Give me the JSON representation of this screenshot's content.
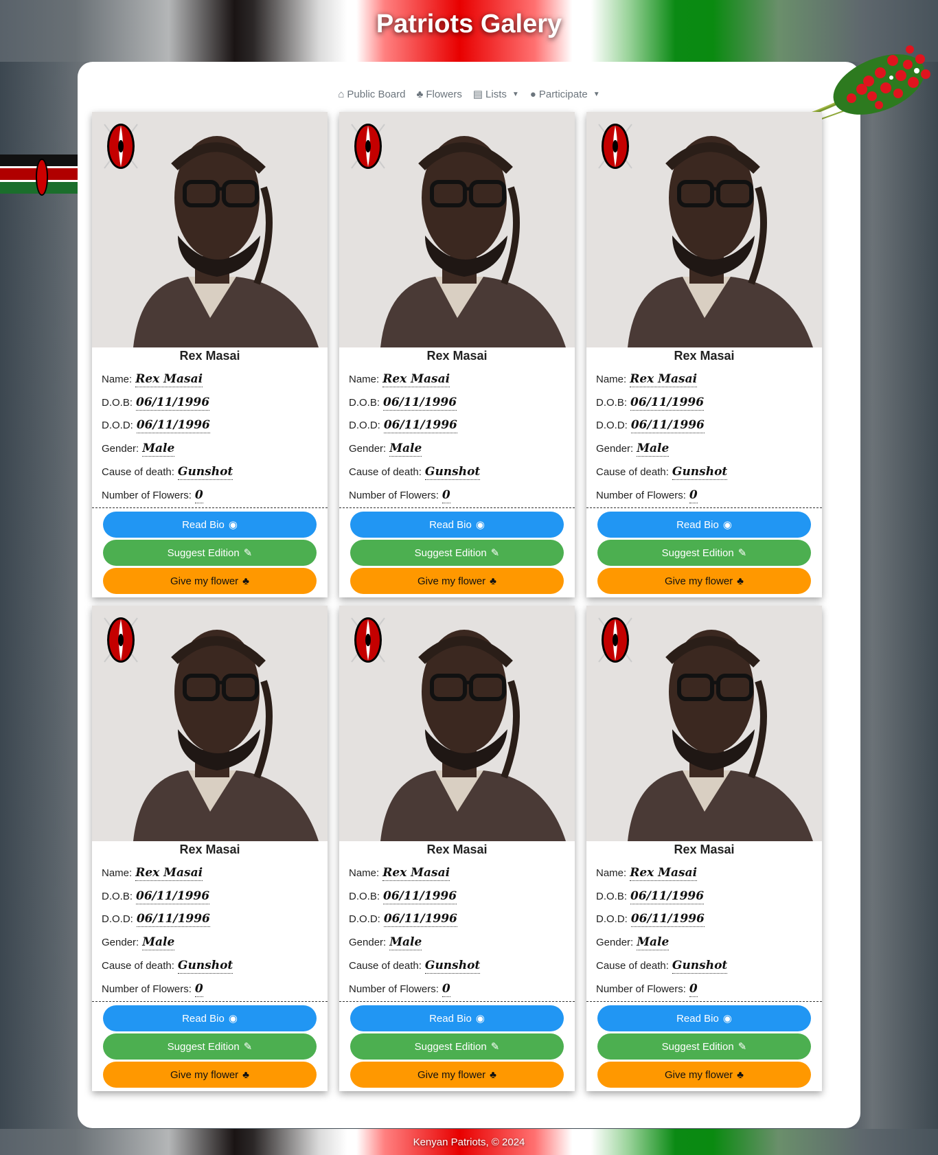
{
  "site": {
    "title": "Patriots Galery",
    "footer": "Kenyan Patriots, © 2024"
  },
  "nav": [
    {
      "icon": "home-icon",
      "glyph": "⌂",
      "label": "Public Board",
      "dropdown": false
    },
    {
      "icon": "tree-icon",
      "glyph": "♣",
      "label": "Flowers",
      "dropdown": false
    },
    {
      "icon": "list-icon",
      "glyph": "▤",
      "label": "Lists",
      "dropdown": true
    },
    {
      "icon": "user-icon",
      "glyph": "●",
      "label": "Participate",
      "dropdown": true
    }
  ],
  "field_labels": {
    "name": "Name:",
    "dob": "D.O.B:",
    "dod": "D.O.D:",
    "gender": "Gender:",
    "cause": "Cause of death:",
    "flowers": "Number of Flowers:"
  },
  "buttons": {
    "read_bio": "Read Bio",
    "suggest": "Suggest Edition",
    "give_flower": "Give my flower"
  },
  "colors": {
    "read_bio": "#2196f3",
    "suggest": "#4caf50",
    "give_flower": "#ff9800"
  },
  "cards": [
    {
      "title": "Rex Masai",
      "name": "Rex Masai",
      "dob": "06/11/1996",
      "dod": "06/11/1996",
      "gender": "Male",
      "cause": "Gunshot",
      "flowers": "0"
    },
    {
      "title": "Rex Masai",
      "name": "Rex Masai",
      "dob": "06/11/1996",
      "dod": "06/11/1996",
      "gender": "Male",
      "cause": "Gunshot",
      "flowers": "0"
    },
    {
      "title": "Rex Masai",
      "name": "Rex Masai",
      "dob": "06/11/1996",
      "dod": "06/11/1996",
      "gender": "Male",
      "cause": "Gunshot",
      "flowers": "0"
    },
    {
      "title": "Rex Masai",
      "name": "Rex Masai",
      "dob": "06/11/1996",
      "dod": "06/11/1996",
      "gender": "Male",
      "cause": "Gunshot",
      "flowers": "0"
    },
    {
      "title": "Rex Masai",
      "name": "Rex Masai",
      "dob": "06/11/1996",
      "dod": "06/11/1996",
      "gender": "Male",
      "cause": "Gunshot",
      "flowers": "0"
    },
    {
      "title": "Rex Masai",
      "name": "Rex Masai",
      "dob": "06/11/1996",
      "dod": "06/11/1996",
      "gender": "Male",
      "cause": "Gunshot",
      "flowers": "0"
    }
  ]
}
